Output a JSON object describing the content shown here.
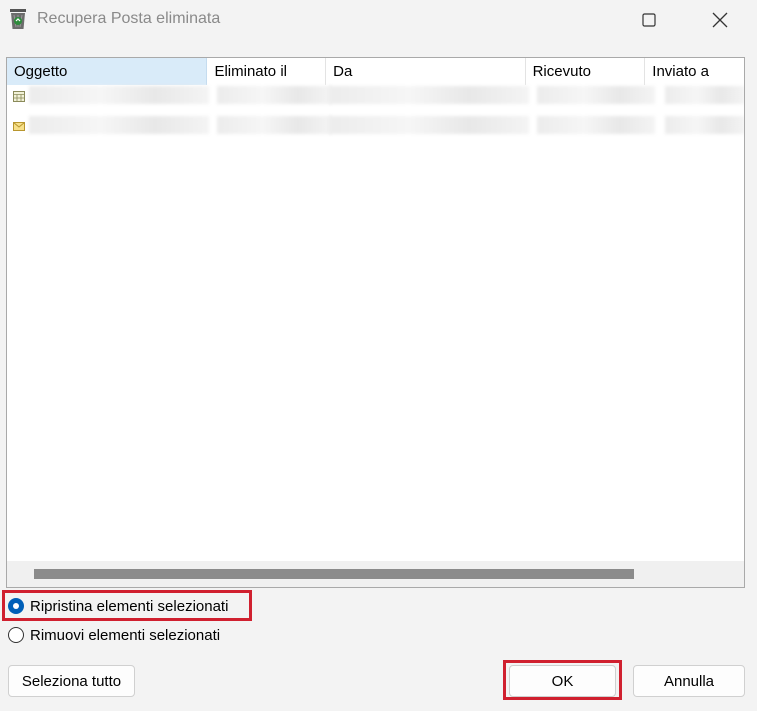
{
  "window": {
    "title": "Recupera Posta eliminata"
  },
  "icons": {
    "app": "recycle-bin-icon",
    "maximize": "maximize-icon",
    "close": "close-icon"
  },
  "listview": {
    "columns": [
      "Oggetto",
      "Eliminato il",
      "Da",
      "Ricevuto",
      "Inviato a"
    ],
    "rows": [
      {
        "icon": "calendar-item-icon"
      },
      {
        "icon": "mail-item-icon"
      }
    ]
  },
  "options": {
    "restore_label": "Ripristina elementi selezionati",
    "remove_label": "Rimuovi elementi selezionati",
    "selected": "restore"
  },
  "buttons": {
    "select_all": "Seleziona tutto",
    "ok": "OK",
    "cancel": "Annulla"
  },
  "colors": {
    "accent": "#005fb8",
    "highlight": "#d0202f"
  }
}
